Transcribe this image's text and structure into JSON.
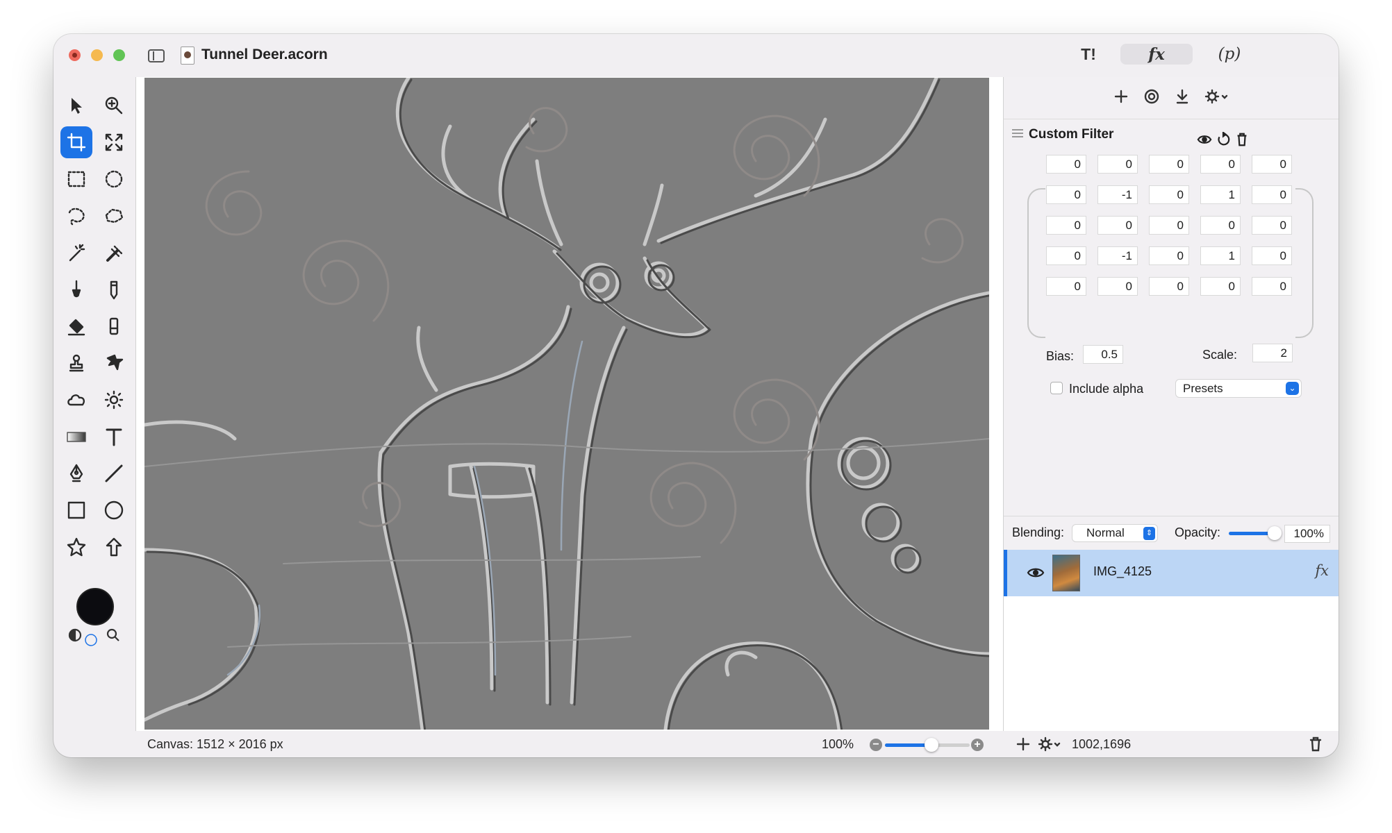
{
  "window": {
    "title": "Tunnel Deer.acorn",
    "toolbar_segments": [
      "T!",
      "fx",
      "(p)"
    ]
  },
  "tools": [
    {
      "name": "arrow-tool-icon"
    },
    {
      "name": "zoom-tool-icon"
    },
    {
      "name": "crop-tool-icon",
      "selected": true
    },
    {
      "name": "transform-tool-icon"
    },
    {
      "name": "rect-select-icon"
    },
    {
      "name": "ellipse-select-icon"
    },
    {
      "name": "lasso-icon"
    },
    {
      "name": "polygon-lasso-icon"
    },
    {
      "name": "magic-wand-icon"
    },
    {
      "name": "instant-alpha-icon"
    },
    {
      "name": "brush-icon"
    },
    {
      "name": "pencil-icon"
    },
    {
      "name": "paint-bucket-icon"
    },
    {
      "name": "eraser-icon"
    },
    {
      "name": "clone-stamp-icon"
    },
    {
      "name": "smudge-icon"
    },
    {
      "name": "burn-icon"
    },
    {
      "name": "dodge-icon"
    },
    {
      "name": "gradient-icon"
    },
    {
      "name": "text-icon"
    },
    {
      "name": "pen-icon"
    },
    {
      "name": "line-icon"
    },
    {
      "name": "rectangle-shape-icon"
    },
    {
      "name": "oval-shape-icon"
    },
    {
      "name": "star-shape-icon"
    },
    {
      "name": "arrow-shape-icon"
    }
  ],
  "colors": {
    "accent": "#1d73e6",
    "foreground_color": "#0c0c10",
    "canvas_gray": "#7e7e7e",
    "layer_selected": "#bcd6f5"
  },
  "status": {
    "canvas_size": "Canvas: 1512 × 2016 px",
    "zoom": "100%",
    "zoom_level": 0.55,
    "coordinates": "1002,1696"
  },
  "filter": {
    "title": "Custom Filter",
    "matrix": [
      [
        "0",
        "0",
        "0",
        "0",
        "0"
      ],
      [
        "0",
        "-1",
        "0",
        "1",
        "0"
      ],
      [
        "0",
        "0",
        "0",
        "0",
        "0"
      ],
      [
        "0",
        "-1",
        "0",
        "1",
        "0"
      ],
      [
        "0",
        "0",
        "0",
        "0",
        "0"
      ]
    ],
    "bias_label": "Bias:",
    "bias": "0.5",
    "scale_label": "Scale:",
    "scale": "2",
    "include_alpha_label": "Include alpha",
    "include_alpha": false,
    "presets_label": "Presets"
  },
  "blending": {
    "label": "Blending:",
    "mode": "Normal",
    "opacity_label": "Opacity:",
    "opacity": "100%",
    "opacity_level": 1.0
  },
  "layers": [
    {
      "name": "IMG_4125",
      "visible": true,
      "selected": true,
      "has_fx": "fx"
    }
  ]
}
